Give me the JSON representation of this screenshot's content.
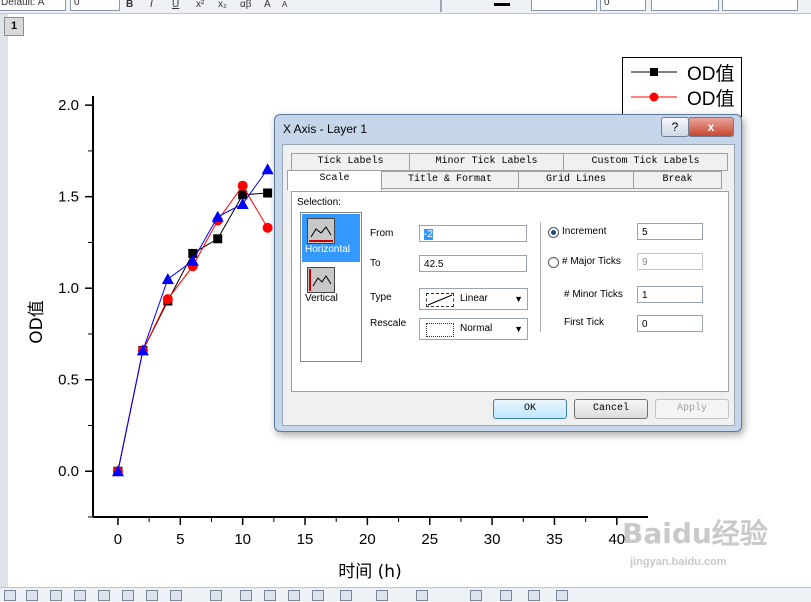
{
  "toolbar": {
    "font_name": "Default: A",
    "font_size": "0",
    "style_buttons": [
      "B",
      "I",
      "U",
      "x²",
      "x₂",
      "αβ",
      "A",
      "A"
    ],
    "line_width": "",
    "point_size": "0"
  },
  "graph": {
    "layer_label": "1",
    "x_axis_title": "时间 (h)",
    "y_axis_title": "OD值",
    "x_ticks": [
      "0",
      "5",
      "10",
      "15",
      "20",
      "25",
      "30",
      "35",
      "40"
    ],
    "y_ticks": [
      "0.0",
      "0.5",
      "1.0",
      "1.5",
      "2.0"
    ],
    "legend": [
      {
        "label": "OD值",
        "color": "#000000",
        "marker": "square"
      },
      {
        "label": "OD值",
        "color": "#ff0000",
        "marker": "circle"
      },
      {
        "label": "OD值",
        "color": "#0000ff",
        "marker": "triangle"
      }
    ]
  },
  "chart_data": {
    "type": "line",
    "xlabel": "时间 (h)",
    "ylabel": "OD值",
    "xlim": [
      -2,
      42.5
    ],
    "ylim": [
      -0.25,
      2.05
    ],
    "x_ticks": [
      0,
      5,
      10,
      15,
      20,
      25,
      30,
      35,
      40
    ],
    "y_ticks": [
      0.0,
      0.5,
      1.0,
      1.5,
      2.0
    ],
    "series": [
      {
        "name": "OD值",
        "color": "#000000",
        "marker": "square",
        "x": [
          0,
          2,
          4,
          6,
          8,
          10,
          12
        ],
        "y": [
          0.0,
          0.66,
          0.93,
          1.19,
          1.27,
          1.51,
          1.52
        ]
      },
      {
        "name": "OD值",
        "color": "#ff0000",
        "marker": "circle",
        "x": [
          0,
          2,
          4,
          6,
          8,
          10,
          12
        ],
        "y": [
          0.0,
          0.66,
          0.94,
          1.12,
          1.37,
          1.56,
          1.33
        ]
      },
      {
        "name": "OD值",
        "color": "#0000ff",
        "marker": "triangle",
        "x": [
          0,
          2,
          4,
          6,
          8,
          10,
          12
        ],
        "y": [
          0.0,
          0.66,
          1.05,
          1.15,
          1.39,
          1.46,
          1.65
        ]
      }
    ]
  },
  "dialog": {
    "title": "X Axis - Layer 1",
    "help_label": "?",
    "close_label": "x",
    "tabs_row1": [
      "Tick Labels",
      "Minor Tick Labels",
      "Custom Tick Labels"
    ],
    "tabs_row2": [
      "Scale",
      "Title & Format",
      "Grid Lines",
      "Break"
    ],
    "active_tab": "Scale",
    "selection_label": "Selection:",
    "selection_items": [
      "Horizontal",
      "Vertical"
    ],
    "from_label": "From",
    "from_value": "-2",
    "to_label": "To",
    "to_value": "42.5",
    "type_label": "Type",
    "type_value": "Linear",
    "rescale_label": "Rescale",
    "rescale_value": "Normal",
    "increment_label": "Increment",
    "increment_value": "5",
    "major_ticks_label": "# Major Ticks",
    "major_ticks_value": "9",
    "minor_ticks_label": "# Minor Ticks",
    "minor_ticks_value": "1",
    "first_tick_label": "First Tick",
    "first_tick_value": "0",
    "ok_label": "OK",
    "cancel_label": "Cancel",
    "apply_label": "Apply"
  },
  "watermark": {
    "text": "Baidu经验",
    "url": "jingyan.baidu.com"
  }
}
